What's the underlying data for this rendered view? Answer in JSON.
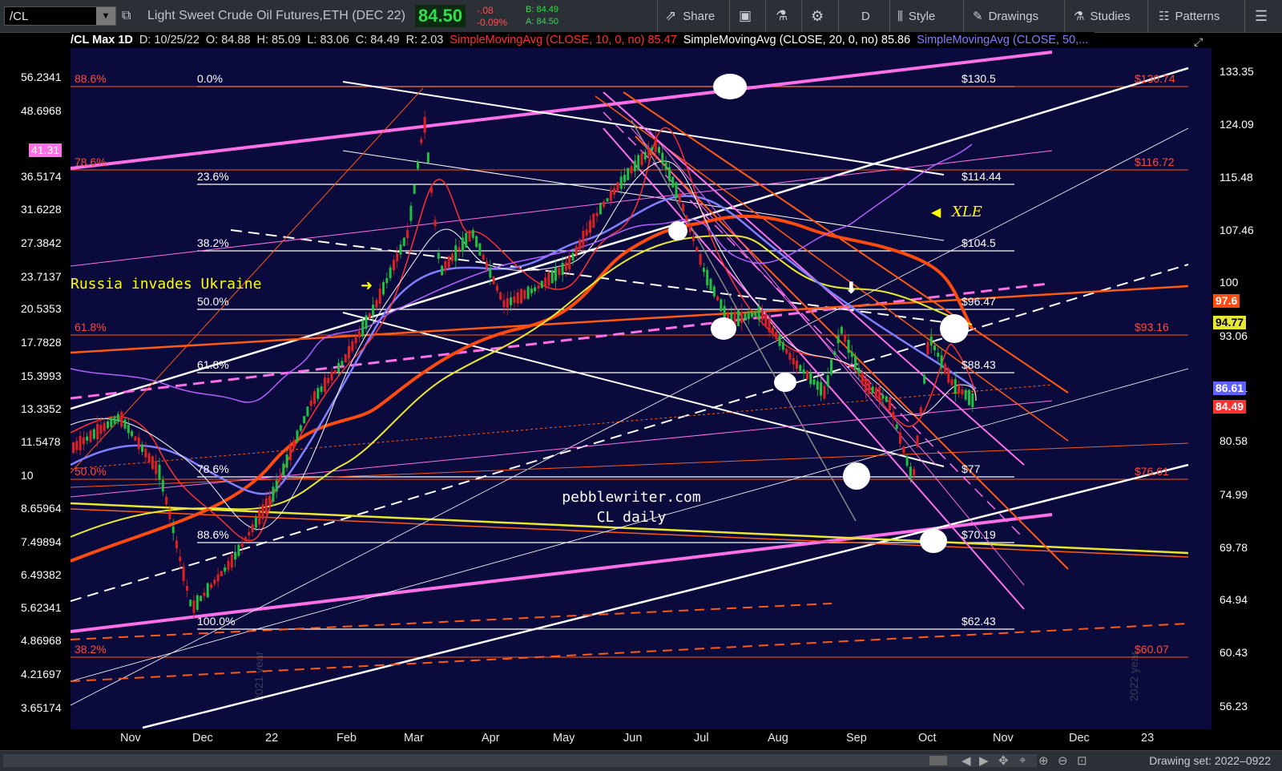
{
  "toolbar": {
    "symbol": "/CL",
    "description": "Light Sweet Crude Oil Futures,ETH (DEC 22)",
    "last_price": "84.50",
    "change": "-.08",
    "change_pct": "-0.09%",
    "bid": "B: 84.49",
    "ask": "A: 84.50",
    "share_label": "Share",
    "timeframe": "D",
    "style_label": "Style",
    "drawings_label": "Drawings",
    "studies_label": "Studies",
    "patterns_label": "Patterns"
  },
  "legend": {
    "symbol": "/CL Max 1D",
    "date": "D: 10/25/22",
    "open": "O: 84.88",
    "high": "H: 85.09",
    "low": "L: 83.06",
    "close": "C: 84.49",
    "range": "R: 2.03",
    "sma10": "SimpleMovingAvg (CLOSE, 10, 0, no)",
    "sma10_val": "85.47",
    "sma20": "SimpleMovingAvg (CLOSE, 20, 0, no)",
    "sma20_val": "85.86",
    "sma50": "SimpleMovingAvg (CLOSE, 50,..."
  },
  "colors": {
    "background": "#0a0a3c",
    "sma10": "#ff3030",
    "sma20": "#ffffff",
    "sma50": "#8080ff",
    "sma100": "#e8e830",
    "sma200": "#ff4a10",
    "fib": "#ffffff",
    "magenta": "#ff70e8",
    "orange": "#ff5a14"
  },
  "left_axis": [
    "56.2341",
    "48.6968",
    "41.31",
    "36.5174",
    "31.6228",
    "27.3842",
    "23.7137",
    "20.5353",
    "17.7828",
    "15.3993",
    "13.3352",
    "11.5478",
    "10",
    "8.65964",
    "7.49894",
    "6.49382",
    "5.62341",
    "4.86968",
    "4.21697",
    "3.65174"
  ],
  "right_axis": [
    "133.35",
    "124.09",
    "115.48",
    "107.46",
    "100",
    "93.06",
    "86.61",
    "80.58",
    "74.99",
    "69.78",
    "64.94",
    "60.43",
    "56.23"
  ],
  "x_axis": [
    "Nov",
    "Dec",
    "22",
    "Feb",
    "Mar",
    "Apr",
    "May",
    "Jun",
    "Jul",
    "Aug",
    "Sep",
    "Oct",
    "Nov",
    "Dec",
    "23"
  ],
  "fib_levels": [
    {
      "pct": "0.0%",
      "price": "$130.5"
    },
    {
      "pct": "23.6%",
      "price": "$114.44"
    },
    {
      "pct": "38.2%",
      "price": "$104.5"
    },
    {
      "pct": "50.0%",
      "price": "$96.47"
    },
    {
      "pct": "61.8%",
      "price": "$88.43"
    },
    {
      "pct": "78.6%",
      "price": "$77"
    },
    {
      "pct": "88.6%",
      "price": "$70.19"
    },
    {
      "pct": "100.0%",
      "price": "$62.43"
    }
  ],
  "orange_levels": [
    {
      "pct": "88.6%",
      "price": "$130.74"
    },
    {
      "pct": "78.6%",
      "price": "$116.72"
    },
    {
      "pct": "61.8%",
      "price": "$93.16"
    },
    {
      "pct": "50.0%",
      "price": "$76.61"
    },
    {
      "pct": "38.2%",
      "price": "$60.07"
    }
  ],
  "price_tags": {
    "p976": "97.6",
    "p9477": "94.77",
    "p8661": "86.61",
    "p8449": "84.49",
    "p4131": "41.31"
  },
  "annotations": {
    "russia": "Russia invades Ukraine",
    "xle": "XLE",
    "site": "pebblewriter.com",
    "subtitle": "CL daily",
    "year2021": "2021 year",
    "year2022": "2022 year"
  },
  "status": {
    "drawing_set": "Drawing set: 2022–0922"
  }
}
